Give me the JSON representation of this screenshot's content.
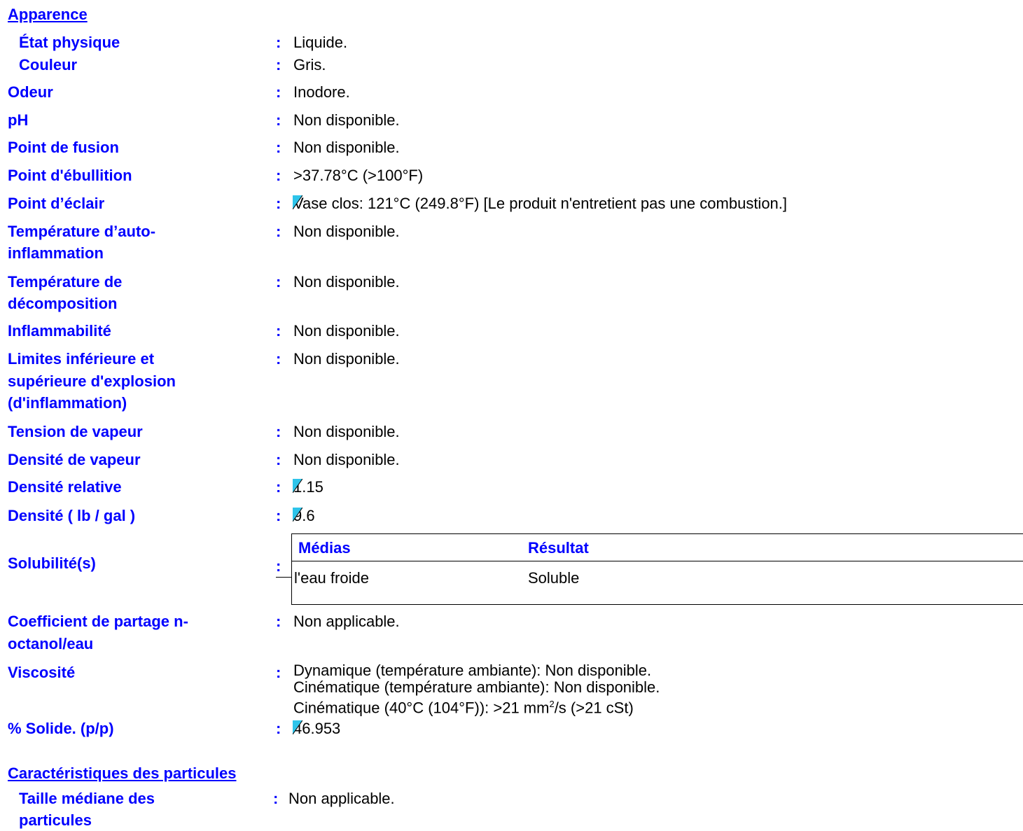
{
  "section_appearance": "Apparence",
  "rows": [
    {
      "label": "État physique",
      "value": "Liquide."
    },
    {
      "label": "Couleur",
      "value": "Gris."
    },
    {
      "label": "Odeur",
      "value": "Inodore."
    },
    {
      "label": "pH",
      "value": "Non disponible."
    },
    {
      "label": "Point de fusion",
      "value": "Non disponible."
    },
    {
      "label": "Point d'ébullition",
      "value": ">37.78°C (>100°F)"
    },
    {
      "label": "Point d’éclair",
      "value": "Vase clos: 121°C (249.8°F) [Le produit n'entretient pas une combustion.]"
    },
    {
      "label_line1": "Température d’auto-",
      "label_line2": "inflammation",
      "value": "Non disponible."
    },
    {
      "label_line1": "Température de",
      "label_line2": "décomposition",
      "value": "Non disponible."
    },
    {
      "label": "Inflammabilité",
      "value": "Non disponible."
    },
    {
      "label_line1": "Limites inférieure et",
      "label_line2": "supérieure d'explosion",
      "label_line3": "(d'inflammation)",
      "value": "Non disponible."
    },
    {
      "label": "Tension de vapeur",
      "value": "Non disponible."
    },
    {
      "label": "Densité de vapeur",
      "value": "Non disponible."
    },
    {
      "label": "Densité relative",
      "value": "1.15"
    },
    {
      "label": "Densité ( lb / gal )",
      "value": "9.6"
    },
    {
      "label": "Solubilité(s)"
    },
    {
      "label_line1": "Coefficient de partage n-",
      "label_line2": "octanol/eau",
      "value": "Non applicable."
    },
    {
      "label": "Viscosité",
      "value_line1": "Dynamique (température ambiante): Non disponible.",
      "value_line2": "Cinématique (température ambiante): Non disponible.",
      "value_line3_pre": "Cinématique (40°C (104°F)): >21 mm",
      "value_line3_sup": "2",
      "value_line3_post": "/s (>21 cSt)"
    },
    {
      "label": "% Solide. (p/p)",
      "value": "46.953"
    }
  ],
  "solubility_table": {
    "headers": [
      "Médias",
      "Résultat"
    ],
    "rows": [
      [
        "l'eau froide",
        "Soluble"
      ]
    ]
  },
  "colon": ":",
  "section_particles": "Caractéristiques des particules",
  "particles": {
    "label_line1": "Taille médiane des",
    "label_line2": "particules",
    "value": "Non applicable."
  },
  "colors": {
    "label": "#0000ff",
    "marker": "#2ec4ea"
  }
}
